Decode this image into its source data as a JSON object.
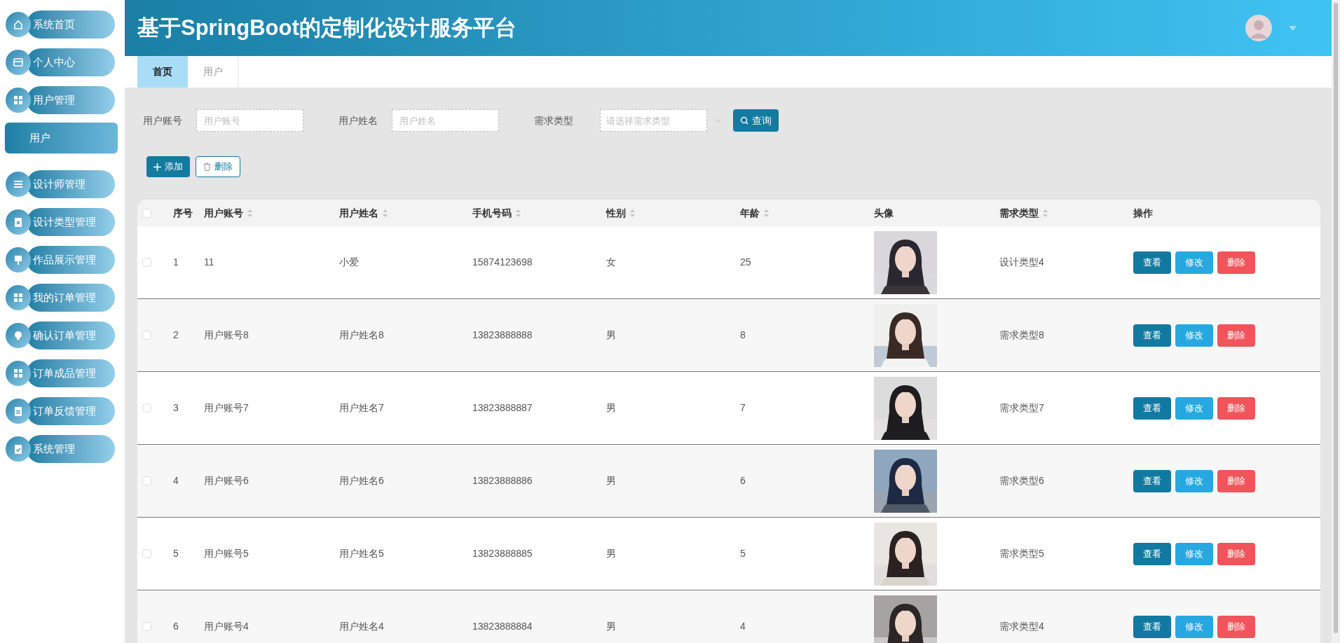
{
  "header": {
    "title": "基于SpringBoot的定制化设计服务平台"
  },
  "sidebar": {
    "items": [
      {
        "label": "系统首页",
        "selected": false
      },
      {
        "label": "个人中心",
        "selected": false
      },
      {
        "label": "用户管理",
        "selected": false,
        "expanded": true,
        "children": [
          {
            "label": "用户",
            "selected": true
          }
        ]
      },
      {
        "label": "设计师管理",
        "selected": false
      },
      {
        "label": "设计类型管理",
        "selected": false
      },
      {
        "label": "作品展示管理",
        "selected": false
      },
      {
        "label": "我的订单管理",
        "selected": false
      },
      {
        "label": "确认订单管理",
        "selected": false
      },
      {
        "label": "订单成品管理",
        "selected": false
      },
      {
        "label": "订单反馈管理",
        "selected": false
      },
      {
        "label": "系统管理",
        "selected": false
      }
    ]
  },
  "tabs": [
    {
      "label": "首页",
      "selected": true
    },
    {
      "label": "用户",
      "selected": false
    }
  ],
  "filters": [
    {
      "kind": "text",
      "label": "用户账号",
      "placeholder": "用户账号"
    },
    {
      "kind": "text",
      "label": "用户姓名",
      "placeholder": "用户姓名"
    },
    {
      "kind": "select",
      "label": "需求类型",
      "placeholder": "请选择需求类型"
    }
  ],
  "search_button": "查询",
  "actions": [
    {
      "kind": "add",
      "label": "添加"
    },
    {
      "kind": "delete",
      "label": "删除"
    }
  ],
  "table": {
    "header_checked": false,
    "columns": [
      {
        "label": "序号",
        "sortable": false
      },
      {
        "label": "用户账号",
        "sortable": true
      },
      {
        "label": "用户姓名",
        "sortable": true
      },
      {
        "label": "手机号码",
        "sortable": true
      },
      {
        "label": "性别",
        "sortable": true
      },
      {
        "label": "年龄",
        "sortable": true
      },
      {
        "label": "头像",
        "sortable": false
      },
      {
        "label": "需求类型",
        "sortable": true
      },
      {
        "label": "操作",
        "sortable": false
      }
    ],
    "rows": [
      {
        "checked": false,
        "cells": [
          "1",
          "11",
          "小爱",
          "15874123698",
          "女",
          "25"
        ],
        "type": "设计类型4",
        "buttons": [
          {
            "kind": "view",
            "label": "查看"
          },
          {
            "kind": "edit",
            "label": "修改"
          },
          {
            "kind": "delete",
            "label": "删除"
          }
        ]
      },
      {
        "checked": false,
        "cells": [
          "2",
          "用户账号8",
          "用户姓名8",
          "13823888888",
          "男",
          "8"
        ],
        "type": "需求类型8",
        "buttons": [
          {
            "kind": "view",
            "label": "查看"
          },
          {
            "kind": "edit",
            "label": "修改"
          },
          {
            "kind": "delete",
            "label": "删除"
          }
        ]
      },
      {
        "checked": false,
        "cells": [
          "3",
          "用户账号7",
          "用户姓名7",
          "13823888887",
          "男",
          "7"
        ],
        "type": "需求类型7",
        "buttons": [
          {
            "kind": "view",
            "label": "查看"
          },
          {
            "kind": "edit",
            "label": "修改"
          },
          {
            "kind": "delete",
            "label": "删除"
          }
        ]
      },
      {
        "checked": false,
        "cells": [
          "4",
          "用户账号6",
          "用户姓名6",
          "13823888886",
          "男",
          "6"
        ],
        "type": "需求类型6",
        "buttons": [
          {
            "kind": "view",
            "label": "查看"
          },
          {
            "kind": "edit",
            "label": "修改"
          },
          {
            "kind": "delete",
            "label": "删除"
          }
        ]
      },
      {
        "checked": false,
        "cells": [
          "5",
          "用户账号5",
          "用户姓名5",
          "13823888885",
          "男",
          "5"
        ],
        "type": "需求类型5",
        "buttons": [
          {
            "kind": "view",
            "label": "查看"
          },
          {
            "kind": "edit",
            "label": "修改"
          },
          {
            "kind": "delete",
            "label": "删除"
          }
        ]
      },
      {
        "checked": false,
        "cells": [
          "6",
          "用户账号4",
          "用户姓名4",
          "13823888884",
          "男",
          "4"
        ],
        "type": "需求类型4",
        "buttons": [
          {
            "kind": "view",
            "label": "查看"
          },
          {
            "kind": "edit",
            "label": "修改"
          },
          {
            "kind": "delete",
            "label": "删除"
          }
        ]
      }
    ]
  }
}
